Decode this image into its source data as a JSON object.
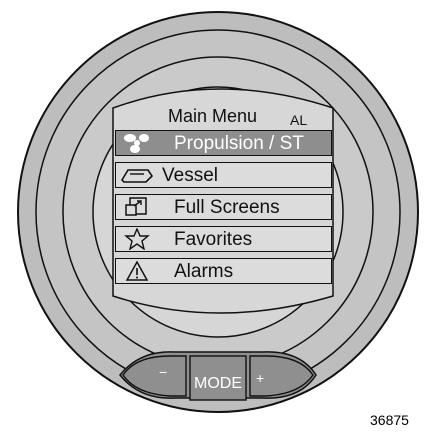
{
  "menu": {
    "title": "Main Menu",
    "badge": "AL",
    "items": [
      {
        "label": "Propulsion / ST",
        "icon": "propeller-icon",
        "selected": true
      },
      {
        "label": "Vessel",
        "icon": "boat-icon",
        "selected": false
      },
      {
        "label": "Full Screens",
        "icon": "full-screen-icon",
        "selected": false
      },
      {
        "label": "Favorites",
        "icon": "star-icon",
        "selected": false
      },
      {
        "label": "Alarms",
        "icon": "warning-icon",
        "selected": false
      }
    ]
  },
  "buttons": {
    "minus": "−",
    "mode": "MODE",
    "plus": "+"
  },
  "figure_number": "36875",
  "colors": {
    "bezel": "#b8b8b8",
    "screen": "#d4d4d4",
    "selected_row": "#8e8e8e"
  }
}
